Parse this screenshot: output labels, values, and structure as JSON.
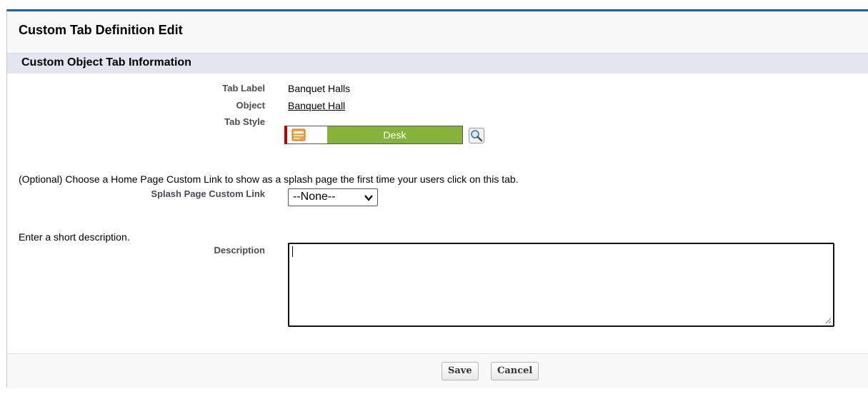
{
  "page": {
    "title": "Custom Tab Definition Edit",
    "section_title": "Custom Object Tab Information"
  },
  "fields": {
    "tab_label": {
      "label": "Tab Label",
      "value": "Banquet Halls"
    },
    "object": {
      "label": "Object",
      "value": "Banquet Hall"
    },
    "tab_style": {
      "label": "Tab Style",
      "value": "Desk",
      "color": "#86b33a",
      "accent": "#c00000",
      "icon": "desk-icon"
    },
    "splash": {
      "note": "(Optional) Choose a Home Page Custom Link to show as a splash page the first time your users click on this tab.",
      "label": "Splash Page Custom Link",
      "selected": "--None--"
    },
    "description": {
      "note": "Enter a short description.",
      "label": "Description",
      "value": ""
    }
  },
  "buttons": {
    "save": "Save",
    "cancel": "Cancel"
  },
  "colors": {
    "header_border": "#1f5f9e",
    "section_bg": "#e3e6ee"
  }
}
